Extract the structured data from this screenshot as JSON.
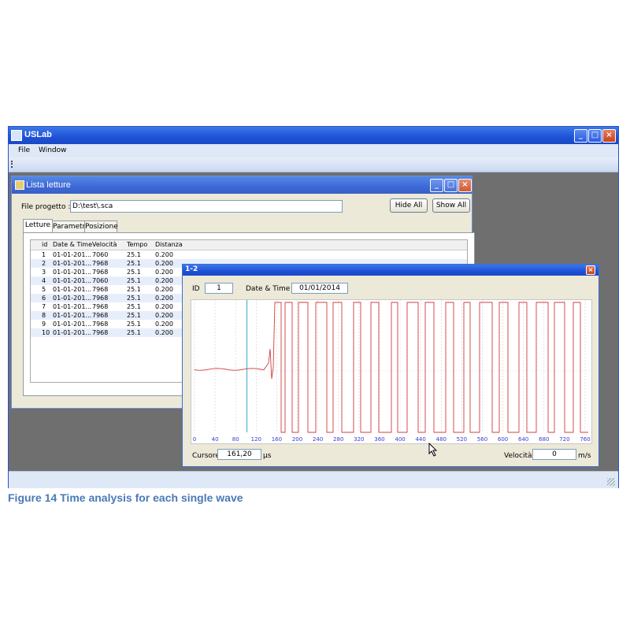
{
  "app": {
    "title": "USLab",
    "menu": [
      "File",
      "Window"
    ]
  },
  "lista": {
    "title": "Lista letture",
    "file_label": "File progetto :",
    "file_value": "D:\\test\\.sca",
    "hide_all": "Hide All",
    "show_all": "Show All",
    "tabs": [
      "Letture",
      "Parametri",
      "Posizione"
    ],
    "columns": [
      "id",
      "Date & Time",
      "Velocità",
      "Tempo",
      "Distanza"
    ],
    "rows": [
      [
        "1",
        "01-01-201...",
        "7060",
        "25.1",
        "0.200"
      ],
      [
        "2",
        "01-01-201...",
        "7968",
        "25.1",
        "0.200"
      ],
      [
        "3",
        "01-01-201...",
        "7968",
        "25.1",
        "0.200"
      ],
      [
        "4",
        "01-01-201...",
        "7060",
        "25.1",
        "0.200"
      ],
      [
        "5",
        "01-01-201...",
        "7968",
        "25.1",
        "0.200"
      ],
      [
        "6",
        "01-01-201...",
        "7968",
        "25.1",
        "0.200"
      ],
      [
        "7",
        "01-01-201...",
        "7968",
        "25.1",
        "0.200"
      ],
      [
        "8",
        "01-01-201...",
        "7968",
        "25.1",
        "0.200"
      ],
      [
        "9",
        "01-01-201...",
        "7968",
        "25.1",
        "0.200"
      ],
      [
        "10",
        "01-01-201...",
        "7968",
        "25.1",
        "0.200"
      ]
    ]
  },
  "wave": {
    "title": "1-2",
    "id_label": "ID",
    "id_value": "1",
    "datetime_label": "Date & Time :",
    "datetime_value": "01/01/2014",
    "x_ticks": [
      "0",
      "40",
      "80",
      "120",
      "160",
      "200",
      "240",
      "280",
      "320",
      "360",
      "400",
      "440",
      "480",
      "520",
      "560",
      "600",
      "640",
      "680",
      "720",
      "760"
    ],
    "cursore_label": "Cursore :",
    "cursore_value": "161,20",
    "cursore_unit": "µs",
    "velocita_label": "Velocità :",
    "velocita_value": "0",
    "velocita_unit": "m/s",
    "colors": {
      "signal": "#d23c3c",
      "cursor": "#3aa6c8"
    }
  },
  "caption": "Figure 14 Time analysis for each single wave"
}
